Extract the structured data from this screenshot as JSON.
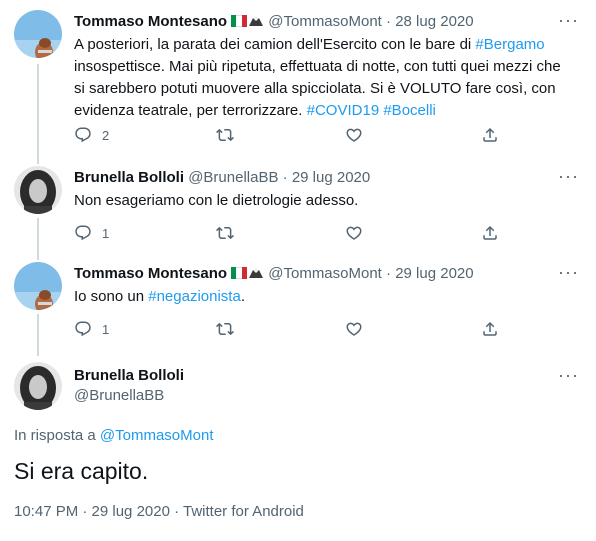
{
  "tweets": [
    {
      "name": "Tommaso Montesano",
      "handle": "@TommasoMont",
      "date": "28 lug 2020",
      "text_parts": [
        "A posteriori, la parata dei camion dell'Esercito con le bare di ",
        "#Bergamo",
        " insospettisce. Mai più ripetuta, effettuata di notte, con tutti quei mezzi che si sarebbero potuti muovere alla spicciolata. Si è VOLUTO fare così, con evidenza teatrale, per terrorizzare. ",
        "#COVID19",
        " ",
        "#Bocelli"
      ],
      "replies": "2",
      "retweets": "",
      "likes": ""
    },
    {
      "name": "Brunella Bolloli",
      "handle": "@BrunellaBB",
      "date": "29 lug 2020",
      "text": "Non esageriamo con le dietrologie adesso.",
      "replies": "1",
      "retweets": "",
      "likes": ""
    },
    {
      "name": "Tommaso Montesano",
      "handle": "@TommasoMont",
      "date": "29 lug 2020",
      "text_parts": [
        "Io sono un ",
        "#negazionista",
        "."
      ],
      "replies": "1",
      "retweets": "",
      "likes": ""
    }
  ],
  "main_tweet": {
    "name": "Brunella Bolloli",
    "handle": "@BrunellaBB",
    "reply_prefix": "In risposta a ",
    "reply_to": "@TommasoMont",
    "text": "Si era capito.",
    "meta": "10:47 PM · 29 lug 2020 · Twitter for Android"
  },
  "separator": " · ",
  "more_label": "···",
  "colors": {
    "accent": "#1d9bf0",
    "text": "#0f1419",
    "muted": "#536471",
    "thread_line": "#cfd9de"
  },
  "icons": [
    "reply-icon",
    "retweet-icon",
    "like-icon",
    "share-icon",
    "more-icon",
    "italy-flag-icon",
    "eagle-icon"
  ]
}
